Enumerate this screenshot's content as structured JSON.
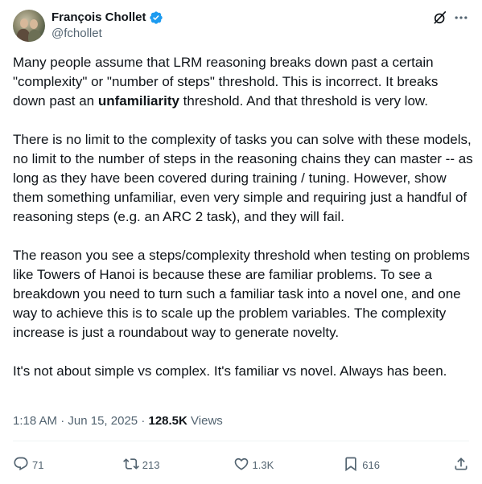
{
  "author": {
    "display_name": "François Chollet",
    "handle": "@fchollet",
    "verified": true
  },
  "post": {
    "paragraph1": {
      "before": "Many people assume that LRM reasoning breaks down past a certain \"complexity\" or \"number of steps\" threshold. This is incorrect. It breaks down past an ",
      "bold": "unfamiliarity",
      "after": " threshold. And that threshold is very low."
    },
    "paragraph2": "There is no limit to the complexity of tasks you can solve with these models, no limit to the number of steps in the reasoning chains they can master -- as long as they have been covered during training / tuning. However, show them something unfamiliar, even very simple and requiring just a handful of reasoning steps (e.g. an ARC 2 task), and they will fail.",
    "paragraph3": "The reason you see a steps/complexity threshold when testing on problems like Towers of Hanoi is because these are familiar problems. To see a breakdown you need to turn such a familiar task into a novel one, and one way to achieve this is to scale up the problem variables. The complexity increase is just a roundabout way to generate novelty.",
    "paragraph4": "It's not about simple vs complex. It's familiar vs novel. Always has been."
  },
  "meta": {
    "time": "1:18 AM",
    "separator": "·",
    "date": "Jun 15, 2025",
    "views_count": "128.5K",
    "views_label": "Views"
  },
  "actions": {
    "replies": "71",
    "reposts": "213",
    "likes": "1.3K",
    "bookmarks": "616"
  },
  "colors": {
    "text": "#0f1419",
    "secondary": "#536471",
    "verified_blue": "#1d9bf0",
    "divider": "#eff3f4"
  },
  "icons": [
    "verified-badge-icon",
    "grok-icon",
    "more-icon",
    "reply-icon",
    "repost-icon",
    "like-icon",
    "bookmark-icon",
    "share-icon"
  ]
}
